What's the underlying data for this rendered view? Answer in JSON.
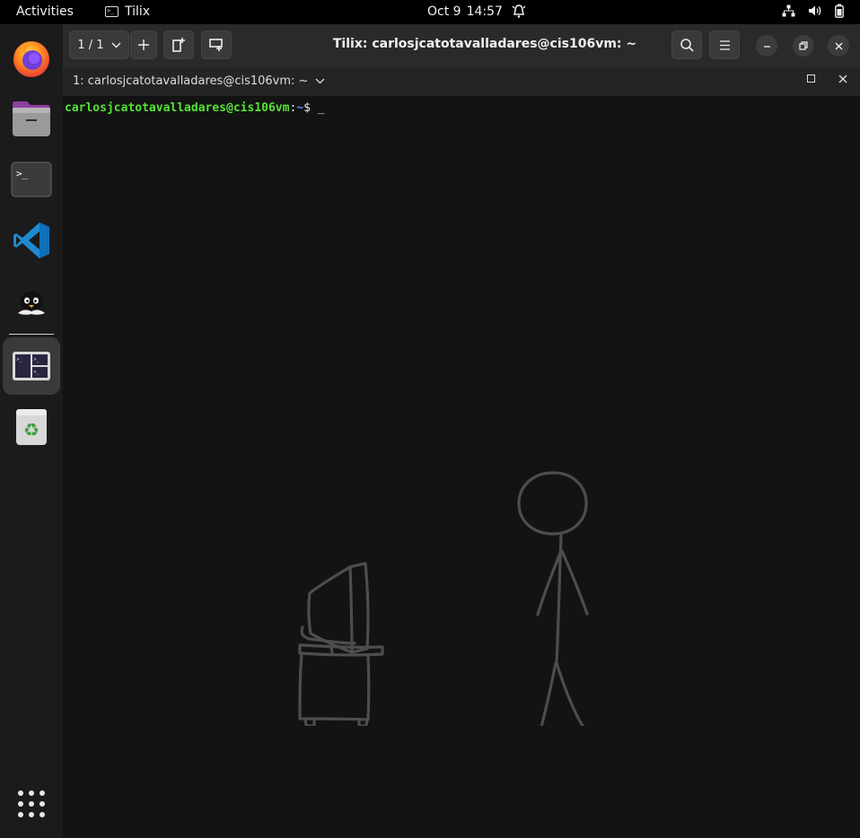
{
  "topbar": {
    "activities": "Activities",
    "app_name": "Tilix",
    "date": "Oct 9",
    "time": "14:57",
    "icons": [
      "bell-icon",
      "network-icon",
      "volume-icon",
      "battery-icon"
    ]
  },
  "dock": {
    "items": [
      "firefox",
      "files",
      "terminal",
      "vscode",
      "gimp-penguin",
      "tilix",
      "trash"
    ],
    "running_indicator_color": "#e95aa8"
  },
  "window": {
    "session_counter": "1 / 1",
    "title": "Tilix: carlosjcatotavalladares@cis106vm: ~",
    "tab_label": "1: carlosjcatotavalladares@cis106vm: ~",
    "header_icons": [
      "add-icon",
      "add-terminal-right-icon",
      "add-terminal-down-icon",
      "search-icon",
      "menu-icon",
      "minimize-icon",
      "restore-icon",
      "close-icon"
    ]
  },
  "terminal": {
    "user_host": "carlosjcatotavalladares@cis106vm",
    "colon": ":",
    "path": "~",
    "symbol": "$",
    "cursor": "_",
    "colors": {
      "background": "#131313",
      "user": "#55e335",
      "path": "#5e8de8"
    }
  }
}
